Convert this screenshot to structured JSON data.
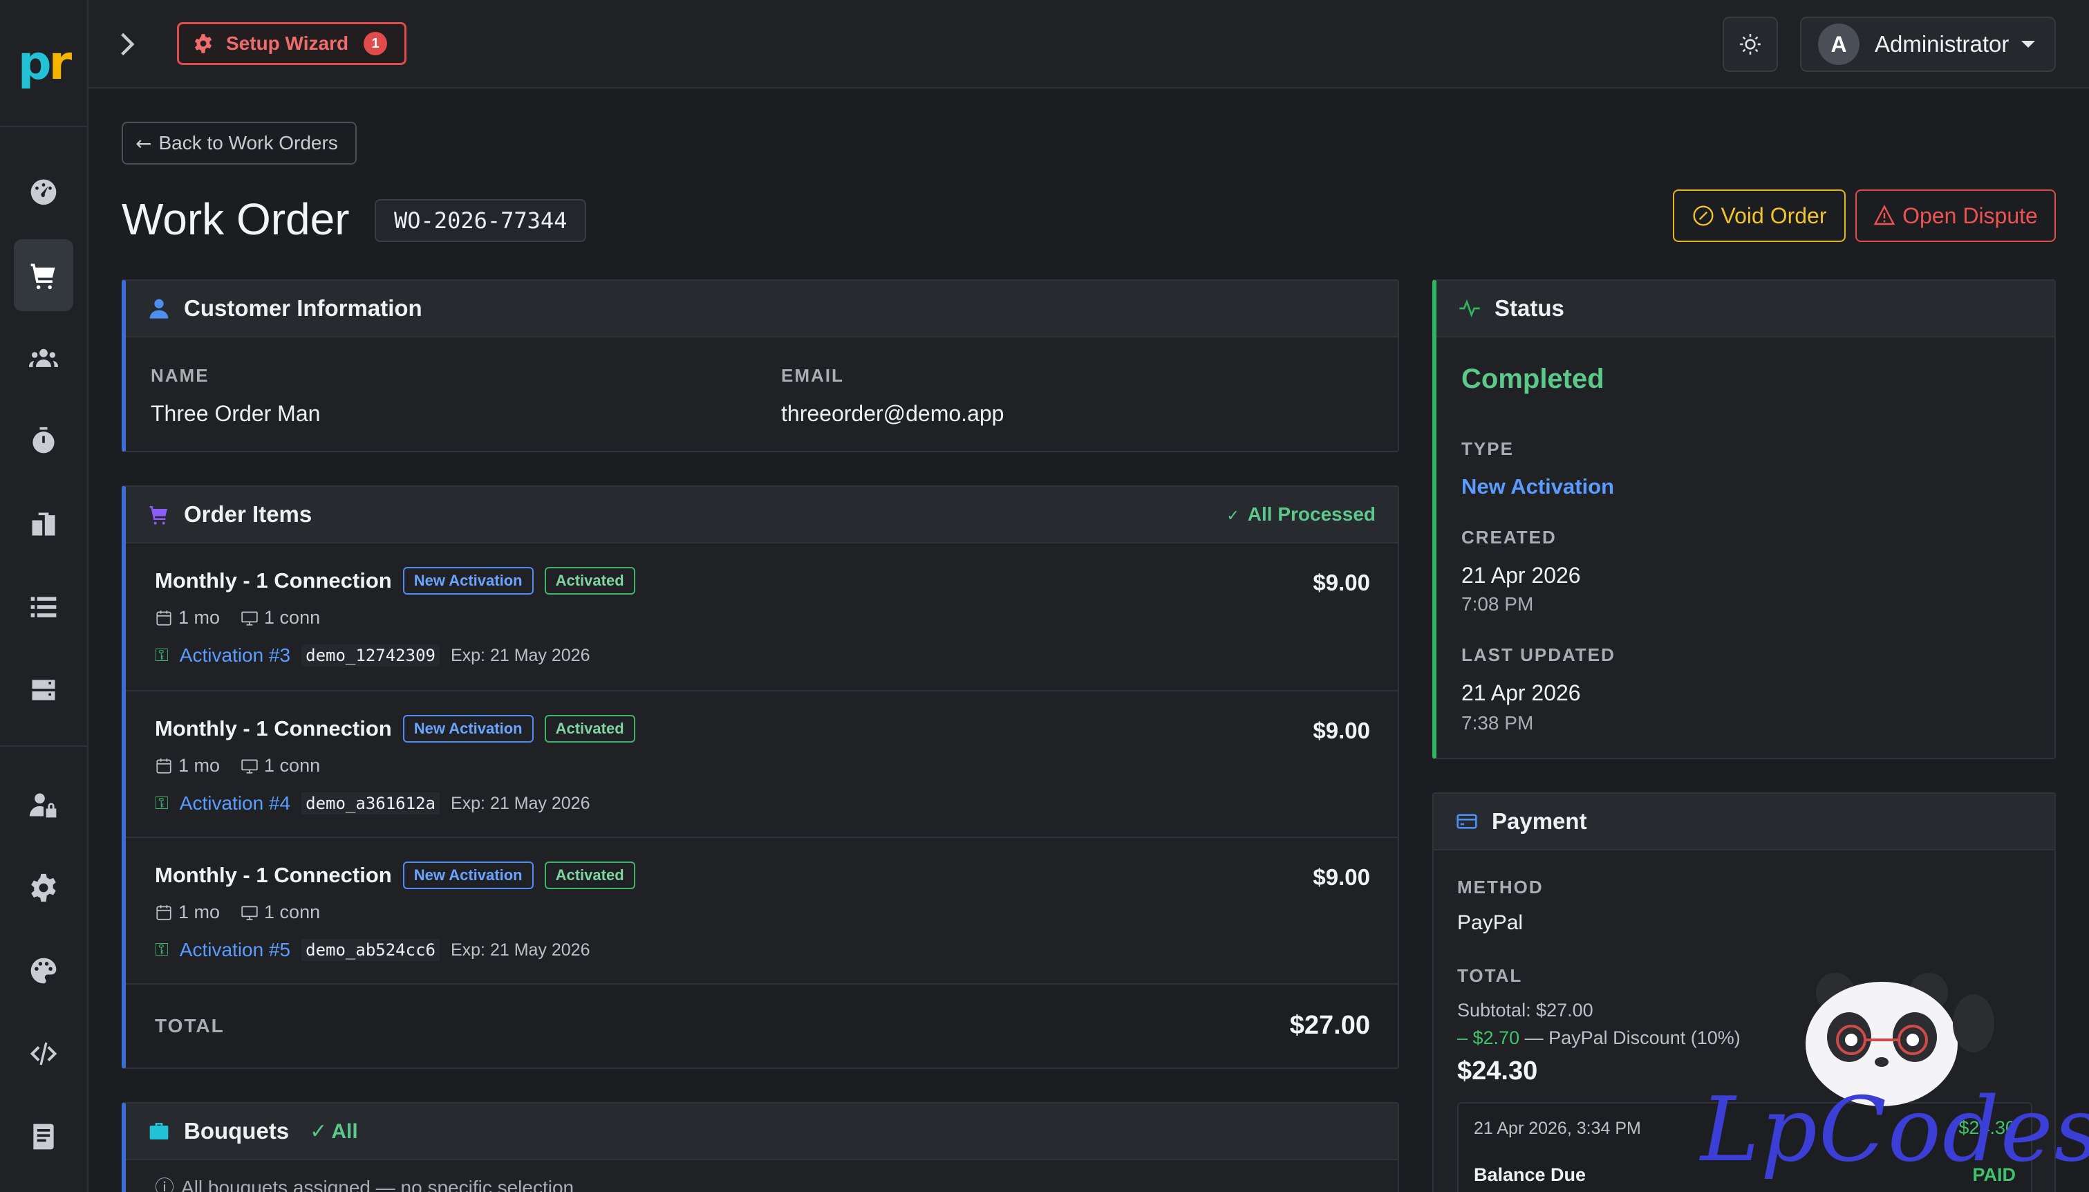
{
  "app": {
    "logo_text_1": "p",
    "logo_text_2": "r"
  },
  "topbar": {
    "setup_wizard_label": "Setup Wizard",
    "setup_wizard_badge": "1",
    "user_avatar_letter": "A",
    "user_name": "Administrator"
  },
  "sidebar": {
    "items": [
      {
        "icon": "dashboard-icon"
      },
      {
        "icon": "cart-icon",
        "active": true
      },
      {
        "icon": "users-icon"
      },
      {
        "icon": "stopwatch-icon"
      },
      {
        "icon": "packages-icon"
      },
      {
        "icon": "list-icon"
      },
      {
        "icon": "server-icon"
      },
      {
        "icon": "user-lock-icon"
      },
      {
        "icon": "gear-icon"
      },
      {
        "icon": "palette-icon"
      },
      {
        "icon": "code-icon"
      },
      {
        "icon": "book-icon"
      }
    ]
  },
  "page": {
    "back_label": "Back to Work Orders",
    "title": "Work Order",
    "order_code": "WO-2026-77344",
    "void_label": "Void Order",
    "dispute_label": "Open Dispute"
  },
  "customer": {
    "heading": "Customer Information",
    "name_label": "NAME",
    "name_value": "Three Order Man",
    "email_label": "EMAIL",
    "email_value": "threeorder@demo.app"
  },
  "order_items": {
    "heading": "Order Items",
    "status": "All Processed",
    "items": [
      {
        "name": "Monthly - 1 Connection",
        "type_badge": "New Activation",
        "state_badge": "Activated",
        "duration": "1 mo",
        "connections": "1 conn",
        "activation": "Activation #3",
        "code": "demo_12742309",
        "expiry": "Exp: 21 May 2026",
        "price": "$9.00"
      },
      {
        "name": "Monthly - 1 Connection",
        "type_badge": "New Activation",
        "state_badge": "Activated",
        "duration": "1 mo",
        "connections": "1 conn",
        "activation": "Activation #4",
        "code": "demo_a361612a",
        "expiry": "Exp: 21 May 2026",
        "price": "$9.00"
      },
      {
        "name": "Monthly - 1 Connection",
        "type_badge": "New Activation",
        "state_badge": "Activated",
        "duration": "1 mo",
        "connections": "1 conn",
        "activation": "Activation #5",
        "code": "demo_ab524cc6",
        "expiry": "Exp: 21 May 2026",
        "price": "$9.00"
      }
    ],
    "total_label": "TOTAL",
    "total_value": "$27.00"
  },
  "bouquets": {
    "heading": "Bouquets",
    "status": "All",
    "note": "All bouquets assigned — no specific selection"
  },
  "status_card": {
    "heading": "Status",
    "state": "Completed",
    "type_label": "TYPE",
    "type_value": "New Activation",
    "created_label": "CREATED",
    "created_date": "21 Apr 2026",
    "created_time": "7:08 PM",
    "updated_label": "LAST UPDATED",
    "updated_date": "21 Apr 2026",
    "updated_time": "7:38 PM"
  },
  "payment": {
    "heading": "Payment",
    "method_label": "METHOD",
    "method_value": "PayPal",
    "total_label": "TOTAL",
    "subtotal": "Subtotal: $27.00",
    "discount_amount": "– $2.70",
    "discount_desc": "— PayPal Discount (10%)",
    "grand_total": "$24.30",
    "txn_datetime": "21 Apr 2026, 3:34 PM",
    "txn_amount": "$24.30",
    "balance_label": "Balance Due",
    "balance_status": "PAID"
  },
  "watermark": {
    "text": "LpCodes"
  },
  "colors": {
    "accent_blue": "#5a9cff",
    "success_green": "#2fb563",
    "danger_red": "#e04b4b",
    "warning_yellow": "#e6b61d",
    "cart_purple": "#8b5cf6",
    "bouquet_teal": "#22c1d6"
  }
}
